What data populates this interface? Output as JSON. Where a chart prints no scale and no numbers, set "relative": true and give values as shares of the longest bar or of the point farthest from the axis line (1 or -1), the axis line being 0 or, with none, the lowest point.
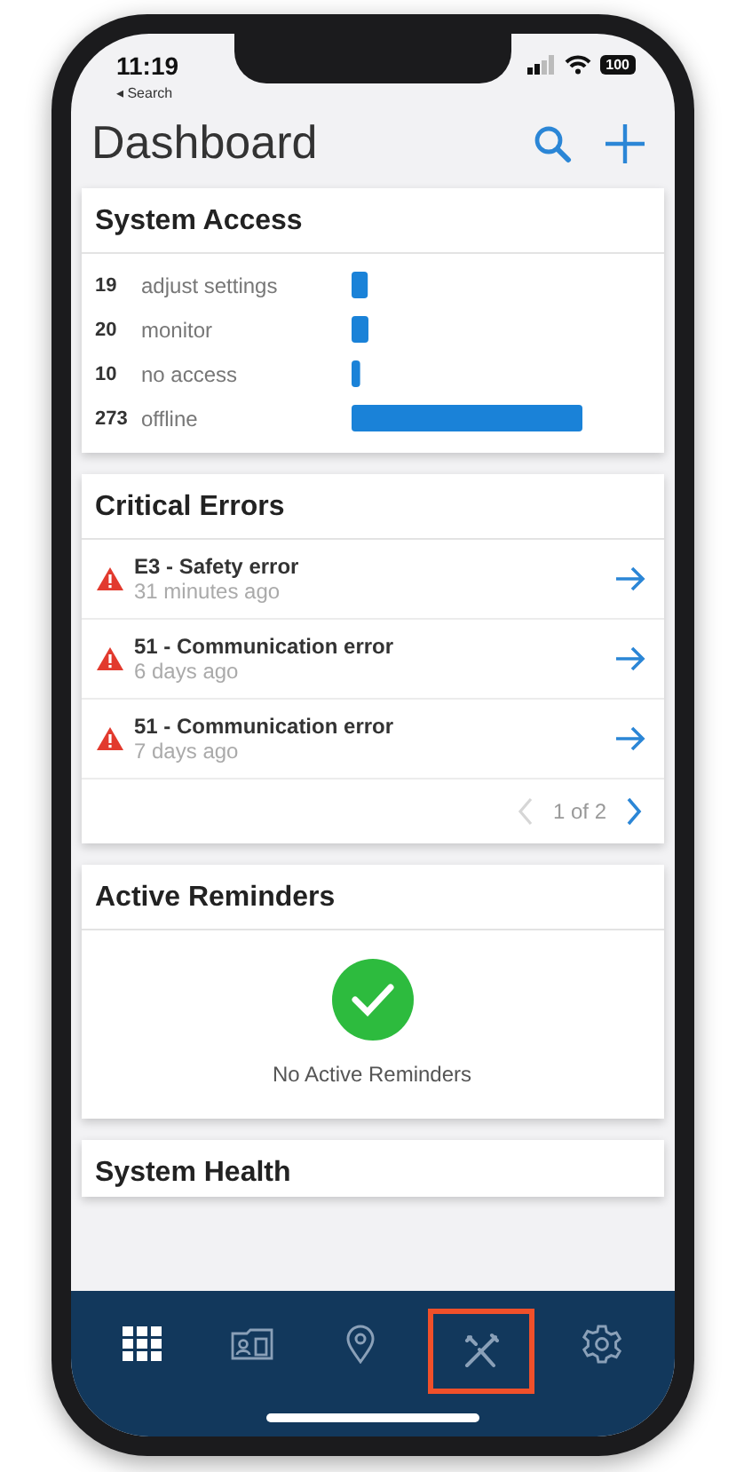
{
  "status_bar": {
    "time": "11:19",
    "back_label": "◂ Search",
    "battery": "100"
  },
  "header": {
    "title": "Dashboard"
  },
  "system_access": {
    "title": "System Access",
    "counts": [
      "19",
      "20",
      "10",
      "273"
    ],
    "chart_data": {
      "type": "bar",
      "orientation": "horizontal",
      "relative": true,
      "categories": [
        "adjust settings",
        "monitor",
        "no access",
        "offline"
      ],
      "values": [
        0.07,
        0.073,
        0.037,
        1
      ]
    }
  },
  "critical_errors": {
    "title": "Critical Errors",
    "items": [
      {
        "title": "E3 - Safety error",
        "time": "31 minutes ago"
      },
      {
        "title": "51 - Communication error",
        "time": "6 days ago"
      },
      {
        "title": "51 - Communication error",
        "time": "7 days ago"
      }
    ],
    "pager": {
      "text": "1 of 2",
      "prev_disabled": true,
      "next_disabled": false
    }
  },
  "active_reminders": {
    "title": "Active Reminders",
    "message": "No Active Reminders"
  },
  "system_health": {
    "title": "System Health"
  },
  "tab_bar": [
    {
      "kind": "grid",
      "selected": true,
      "highlighted": false
    },
    {
      "kind": "card",
      "selected": false,
      "highlighted": false
    },
    {
      "kind": "pin",
      "selected": false,
      "highlighted": false
    },
    {
      "kind": "tools",
      "selected": false,
      "highlighted": true
    },
    {
      "kind": "gear",
      "selected": false,
      "highlighted": false
    }
  ]
}
